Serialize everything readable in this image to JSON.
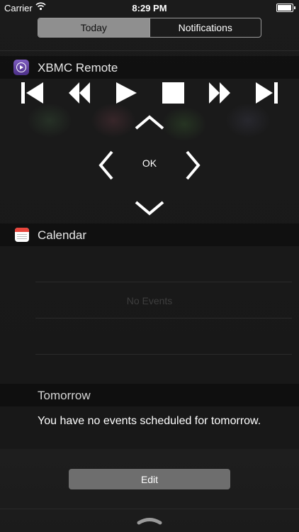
{
  "status_bar": {
    "carrier": "Carrier",
    "time": "8:29 PM"
  },
  "tabs": {
    "today": "Today",
    "notifications": "Notifications"
  },
  "xbmc": {
    "title": "XBMC Remote",
    "ok_label": "OK"
  },
  "calendar": {
    "title": "Calendar",
    "no_events": "No Events",
    "tomorrow_label": "Tomorrow",
    "tomorrow_message": "You have no events scheduled for tomorrow."
  },
  "footer": {
    "edit_label": "Edit"
  },
  "icons": {
    "xbmc_app": "xbmc-app-icon",
    "calendar_app": "calendar-app-icon",
    "wifi": "wifi-icon",
    "battery": "battery-icon",
    "skip_back": "skip-back-icon",
    "rewind": "rewind-icon",
    "play": "play-icon",
    "stop": "stop-icon",
    "fast_forward": "fast-forward-icon",
    "skip_forward": "skip-forward-icon",
    "up": "chevron-up-icon",
    "down": "chevron-down-icon",
    "left": "chevron-left-icon",
    "right": "chevron-right-icon",
    "pull_handle": "pull-handle-icon"
  }
}
